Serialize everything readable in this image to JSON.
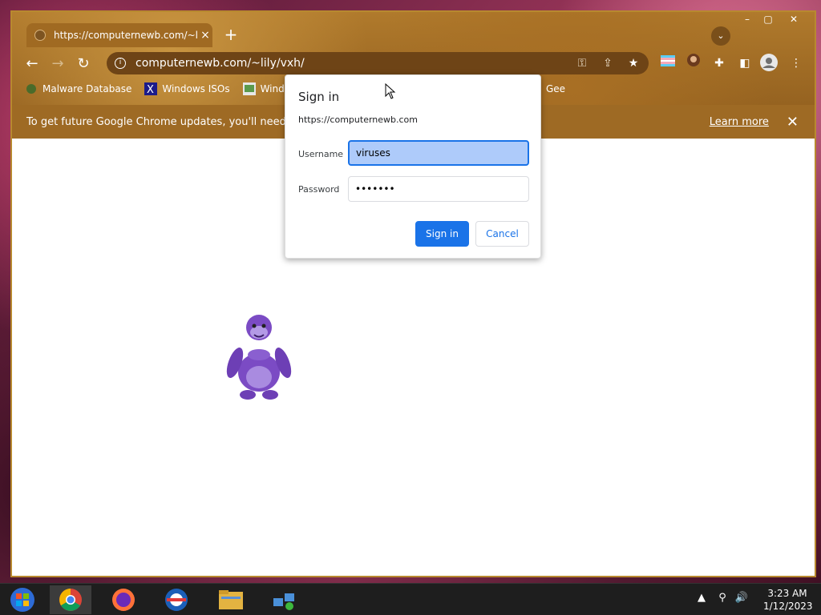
{
  "browser": {
    "tab_title": "https://computernewb.com/~lily/",
    "tab_close": "×",
    "new_tab": "+",
    "url": "computernewb.com/~lily/vxh/",
    "bookmarks": [
      {
        "label": "Malware Database",
        "icon": "malware-icon"
      },
      {
        "label": "Windows ISOs",
        "icon": "x-icon"
      },
      {
        "label": "Windows",
        "icon": "windows-icon"
      },
      {
        "label": "Gee",
        "icon": "folder-icon"
      }
    ],
    "infobar": {
      "message": "To get future Google Chrome updates, you'll need Window",
      "learn_more": "Learn more",
      "close": "✕"
    }
  },
  "dialog": {
    "title": "Sign in",
    "origin": "https://computernewb.com",
    "username_label": "Username",
    "username_value": "viruses",
    "password_label": "Password",
    "password_value": "•••••••",
    "signin_button": "Sign in",
    "cancel_button": "Cancel"
  },
  "taskbar": {
    "time": "3:23 AM",
    "date": "1/12/2023"
  },
  "colors": {
    "accent": "#1a73e8",
    "frame": "#a06a22"
  }
}
